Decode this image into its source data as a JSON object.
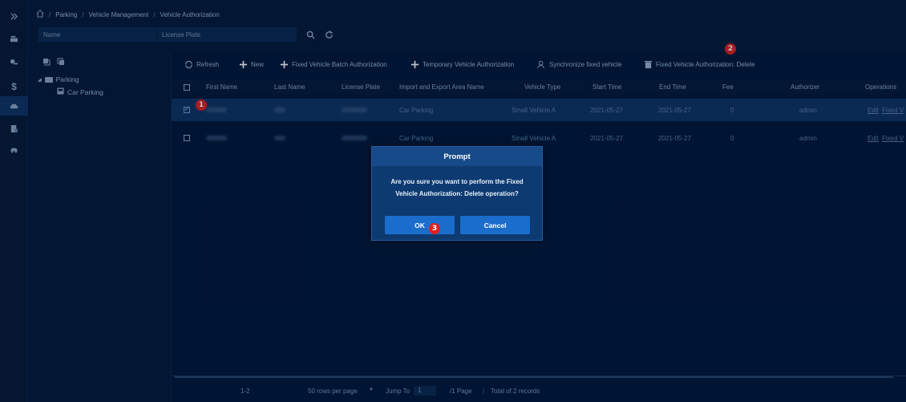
{
  "breadcrumb": [
    "Parking",
    "Vehicle Management",
    "Vehicle Authorization"
  ],
  "filters": {
    "name_label": "Name",
    "plate_label": "License Plate"
  },
  "tree": {
    "root": "Parking",
    "child": "Car Parking"
  },
  "toolbar": {
    "refresh": "Refresh",
    "new": "New",
    "batch": "Fixed Vehicle Batch Authorization",
    "temporary": "Temporary Vehicle Authorization",
    "sync": "Synchronize fixed vehicle",
    "delete": "Fixed Vehicle Authorization: Delete"
  },
  "table": {
    "headers": [
      "First Name",
      "Last Name",
      "License Plate",
      "Import and Export Area Name",
      "Vehicle Type",
      "Start Time",
      "End Time",
      "Fee",
      "Authorizer",
      "Operations"
    ],
    "rows": [
      {
        "area": "Car Parking",
        "type": "Small Vehicle A",
        "start": "2021-05-27",
        "end": "2021-05-27",
        "fee": "0",
        "authorizer": "admin",
        "edit": "Edit",
        "fixed": "Fixed V",
        "selected": true
      },
      {
        "area": "Car Parking",
        "type": "Small Vehicle A",
        "start": "2021-05-27",
        "end": "2021-05-27",
        "fee": "0",
        "authorizer": "admin",
        "edit": "Edit",
        "fixed": "Fixed V",
        "selected": false
      }
    ]
  },
  "footer": {
    "range": "1-2",
    "per_page": "50 rows per page",
    "jump_to": "Jump To",
    "page_value": "1",
    "page_total": "/1 Page",
    "total": "Total of 2 records"
  },
  "dialog": {
    "title": "Prompt",
    "message": "Are you sure you want to perform the Fixed Vehicle Authorization: Delete operation?",
    "ok": "OK",
    "cancel": "Cancel"
  },
  "markers": [
    "1",
    "2",
    "3"
  ],
  "colors": {
    "background": "#01183a",
    "selected_row": "#0f3565",
    "dialog": "#0d3a70",
    "button": "#1b6dcc",
    "marker": "#e02020"
  }
}
